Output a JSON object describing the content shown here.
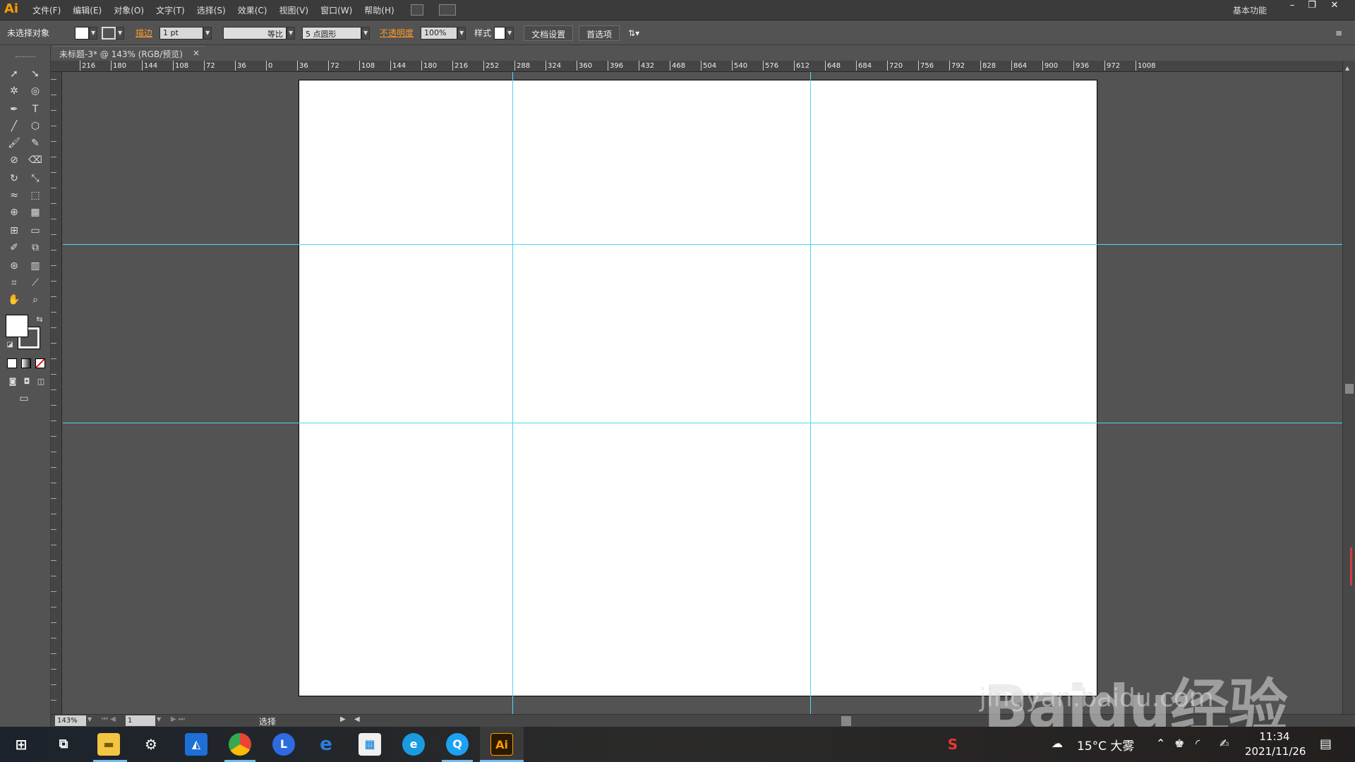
{
  "app": {
    "logo": "Ai",
    "menus": [
      "文件(F)",
      "编辑(E)",
      "对象(O)",
      "文字(T)",
      "选择(S)",
      "效果(C)",
      "视图(V)",
      "窗口(W)",
      "帮助(H)"
    ],
    "workspace": "基本功能",
    "window_controls": {
      "minimize": "–",
      "restore": "❐",
      "close": "✕"
    }
  },
  "controlbar": {
    "selection_status": "未选择对象",
    "stroke_label": "描边",
    "stroke_weight": "1 pt",
    "stroke_profile": "等比",
    "brush": "5 点圆形",
    "opacity_label": "不透明度",
    "opacity_value": "100%",
    "style_label": "样式",
    "doc_setup_button": "文档设置",
    "preferences_button": "首选项"
  },
  "document": {
    "tab_title": "未标题-3* @ 143% (RGB/预览)",
    "tab_close": "×"
  },
  "ruler": {
    "h_ticks": [
      "216",
      "180",
      "144",
      "108",
      "72",
      "36",
      "0",
      "36",
      "72",
      "108",
      "144",
      "180",
      "216",
      "252",
      "288",
      "324",
      "360",
      "396",
      "432",
      "468",
      "504",
      "540",
      "576",
      "612",
      "648",
      "684",
      "720",
      "756",
      "792",
      "828",
      "864",
      "900",
      "936",
      "972",
      "1008"
    ]
  },
  "status": {
    "zoom": "143%",
    "page": "1",
    "mode": "选择"
  },
  "taskbar": {
    "weather": "15°C 大雾",
    "time": "11:34",
    "date": "2021/11/26",
    "ai_label": "Ai"
  },
  "watermark": {
    "brand": "Baidu经验",
    "url": "jingyan.baidu.com"
  },
  "colors": {
    "accent_orange": "#ff9a00",
    "guide_cyan": "#4dd8ef",
    "canvas_gray": "#535353"
  }
}
